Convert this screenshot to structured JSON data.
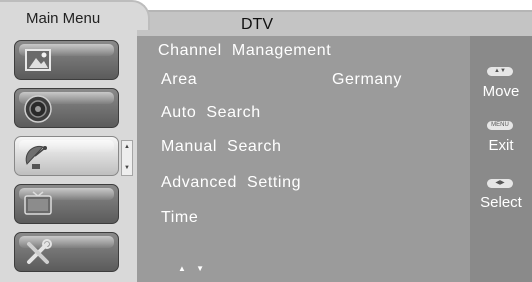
{
  "tabs": {
    "main_menu": "Main Menu",
    "current_source": "DTV"
  },
  "sidebar": {
    "items": [
      {
        "icon": "picture-icon",
        "selected": false
      },
      {
        "icon": "speaker-icon",
        "selected": false
      },
      {
        "icon": "satellite-dish-icon",
        "selected": true
      },
      {
        "icon": "tv-set-icon",
        "selected": false
      },
      {
        "icon": "tools-icon",
        "selected": false
      }
    ],
    "scroll_up": "▲",
    "scroll_down": "▼"
  },
  "menu": {
    "title": "Channel  Management",
    "items": [
      {
        "label": "Area",
        "value": "Germany"
      },
      {
        "label": "Auto  Search"
      },
      {
        "label": "Manual  Search"
      },
      {
        "label": "Advanced  Setting"
      },
      {
        "label": "Time"
      }
    ],
    "page_arrows": "▲ ▼"
  },
  "legend": {
    "move": {
      "key": "▲▼",
      "label": "Move"
    },
    "exit": {
      "key": "MENU",
      "label": "Exit"
    },
    "select": {
      "key": "◀▶",
      "label": "Select"
    }
  },
  "colors": {
    "main_panel": "#9b9b9b",
    "legend_panel": "#8a8a8a",
    "sidebar_bg": "#d9d9d9",
    "text": "#ffffff"
  }
}
